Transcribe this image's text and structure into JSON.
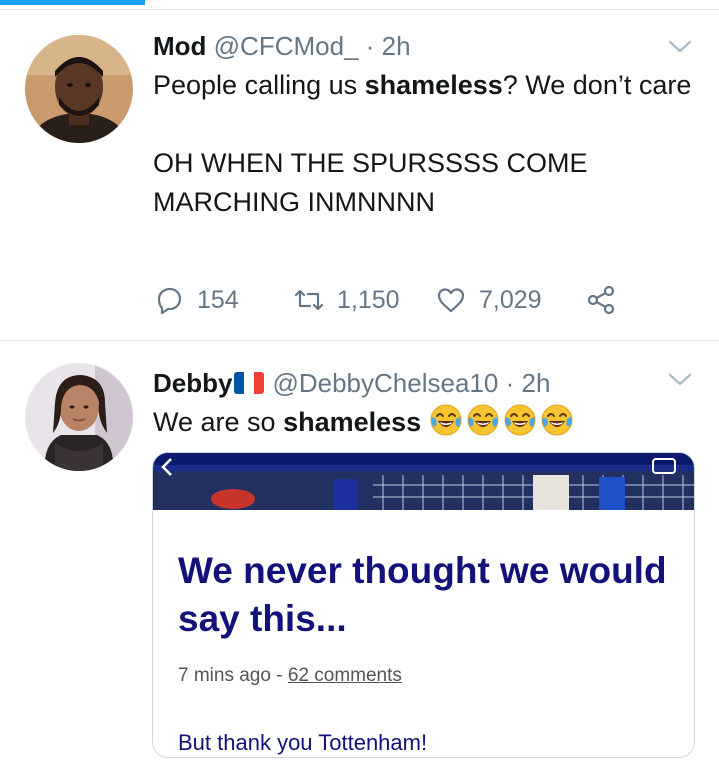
{
  "tweets": [
    {
      "name": "Mod",
      "handle": "@CFCMod_",
      "separator": "·",
      "time": "2h",
      "text_before_bold": "People calling us ",
      "text_bold": "shameless",
      "text_after_bold": "? We don’t care",
      "line2": "OH WHEN THE SPURSSSS COME MARCHING INMNNNN",
      "replies": "154",
      "retweets": "1,150",
      "likes": "7,029"
    },
    {
      "name": "Debby",
      "flag_colors": [
        "#0055a4",
        "#ffffff",
        "#ef4135"
      ],
      "handle": "@DebbyChelsea10",
      "separator": "·",
      "time": "2h",
      "text_before_bold": "We are so ",
      "text_bold": "shameless",
      "emoji": "face-with-tears-of-joy",
      "card": {
        "headline": "We never thought we would say this...",
        "meta_time": "7 mins ago",
        "meta_separator": "-",
        "meta_comments": "62 comments",
        "subtext": "But thank you Tottenham!"
      }
    }
  ],
  "colors": {
    "accent": "#1da1f2",
    "text": "#14171a",
    "secondary": "#657786",
    "card_headline": "#13127a"
  }
}
